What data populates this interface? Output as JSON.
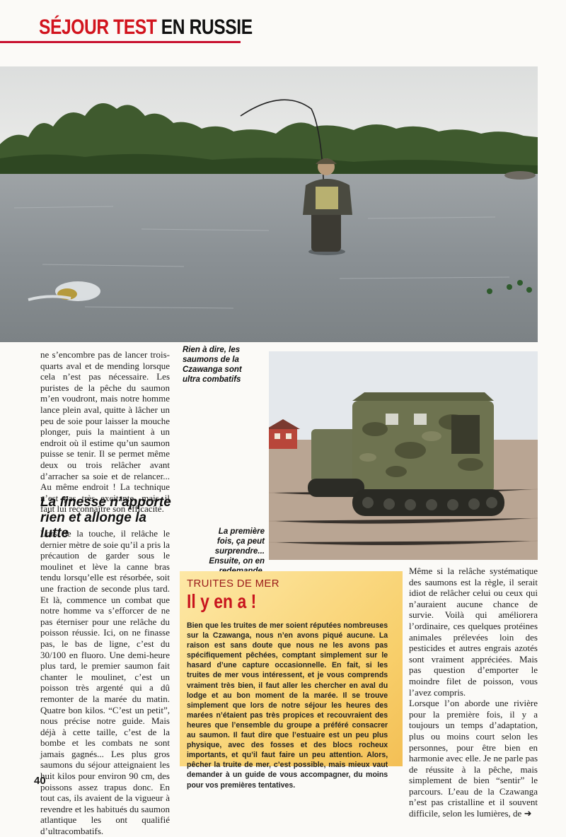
{
  "header": {
    "title_red": "SÉJOUR TEST",
    "title_black": "EN RUSSIE"
  },
  "photos": {
    "top": {
      "caption": ""
    },
    "vehicle": {
      "caption": ""
    }
  },
  "captions": {
    "salmon": "Rien à dire, les saumons de la Czawanga sont ultra combatifs",
    "vehicle": "La première fois, ça peut surprendre... Ensuite, on en redemande."
  },
  "column_left_top": "ne s’encombre pas de lancer trois-quarts aval et de mending lorsque cela n’est pas nécessaire. Les puristes de la pêche du saumon m’en voudront, mais notre homme lance plein aval, quitte à lâcher un peu de soie pour laisser la mouche plonger, puis la maintient à un endroit où il estime qu’un saumon puisse se tenir. Il se permet même deux ou trois relâcher avant d’arracher sa soie et de relancer... Au même endroit ! La technique n’est pas très excitante, mais il faut lui reconnaître son efficacité.",
  "subhead": "La finesse n’apporte rien et allonge la lutte",
  "column_left_bottom": "Lors de la touche, il relâche le dernier mètre de soie qu’il a pris la précaution de garder sous le moulinet et lève la canne bras tendu lorsqu’elle est résorbée, soit une fraction de seconde plus tard. Et là, commence un combat que notre homme va s’efforcer de ne pas éterniser pour une relâche du poisson réussie. Ici, on ne finasse pas, le bas de ligne, c’est du 30/100 en fluoro. Une demi-heure plus tard, le premier saumon fait chanter le moulinet, c’est un poisson très argenté qui a dû remonter de la marée du matin. Quatre bon kilos. “C’est un petit”, nous précise notre guide. Mais déjà à cette taille, c’est de la bombe et les combats ne sont jamais gagnés... Les plus gros saumons du séjour atteignaient les huit kilos pour environ 90 cm, des poissons assez trapus donc. En tout cas, ils avaient de la vigueur à revendre et les habitués du saumon atlantique les ont qualifié d’ultracombatifs.",
  "box": {
    "kicker": "TRUITES DE MER",
    "title": "Il y en a !",
    "text": "Bien que les truites de mer soient réputées nombreuses sur la Czawanga, nous n’en avons piqué aucune. La raison est sans doute que nous ne les avons pas spécifiquement pêchées, comptant simplement sur le hasard d’une capture occasionnelle. En fait, si les truites de mer vous intéressent, et je vous comprends vraiment très bien, il faut aller les chercher en aval du lodge et au bon moment de la marée. Il se trouve simplement que lors de notre séjour les heures des marées n’étaient pas très propices et recouvraient des heures que l’ensemble du groupe a préféré consacrer au saumon. Il faut dire que l’estuaire est un peu plus physique, avec des fosses et des blocs rocheux importants, et qu’il faut faire un peu attention. Alors, pêcher la truite de mer, c’est possible, mais mieux vaut demander à un guide de vous accompagner, du moins pour vos premières tentatives."
  },
  "column_right": "Même si la relâche systématique des saumons est la règle, il serait idiot de relâcher celui ou ceux qui n’auraient aucune chance de survie. Voilà qui améliorera l’ordinaire, ces quelques protéines animales prélevées loin des pesticides et autres engrais azotés sont vraiment appréciées. Mais pas question d’emporter le moindre filet de poisson, vous l’avez compris.",
  "column_right_2": "Lorsque l’on aborde une rivière pour la première fois, il y a toujours un temps d’adaptation, plus ou moins court selon les personnes, pour être bien en harmonie avec elle. Je ne parle pas de réussite à la pêche, mais simplement de bien “sentir” le parcours. L’eau de la Czawanga n’est pas cristalline et il souvent difficile, selon les lumières, de",
  "continue_arrow": "➜",
  "page_number": "40"
}
